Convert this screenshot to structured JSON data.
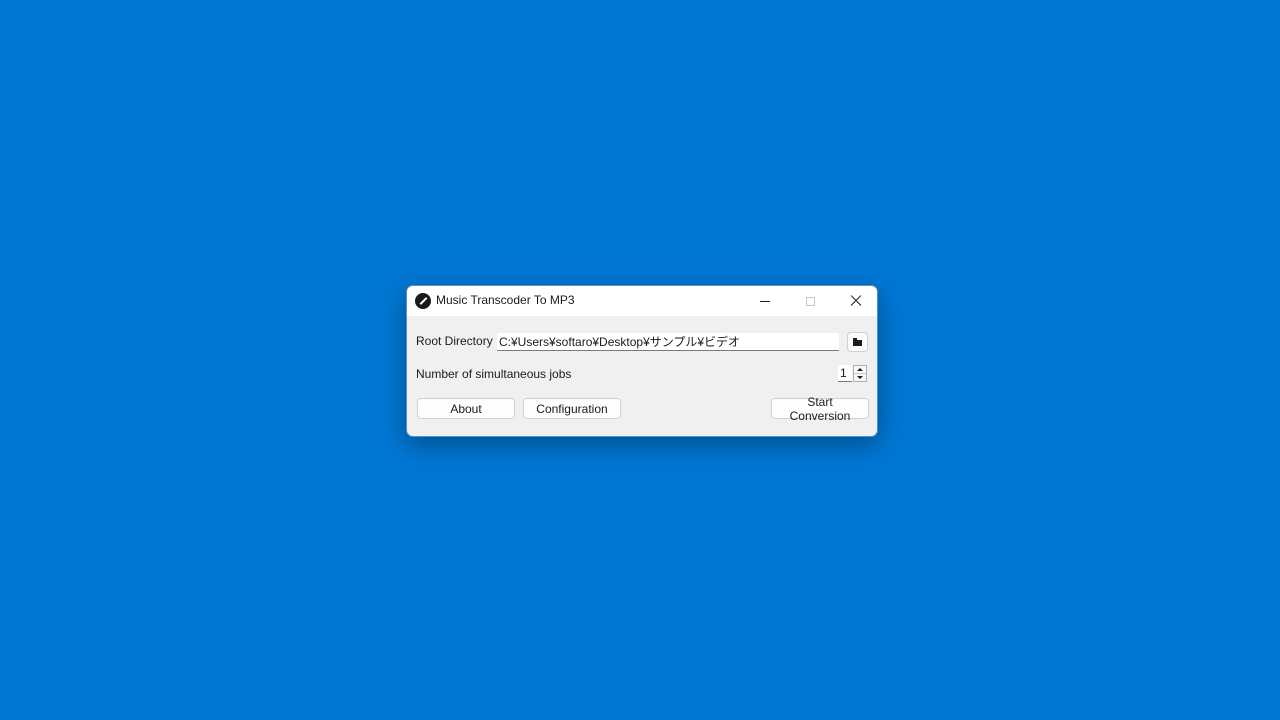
{
  "window": {
    "title": "Music Transcoder To MP3",
    "icon": "app-disc-icon"
  },
  "titlebar_controls": {
    "minimize": "minimize-icon",
    "maximize": "maximize-icon",
    "close": "close-icon"
  },
  "form": {
    "root_directory_label": "Root Directory",
    "root_directory_value": "C:¥Users¥softaro¥Desktop¥サンプル¥ビデオ",
    "browse_icon": "folder-icon",
    "jobs_label": "Number of simultaneous jobs",
    "jobs_value": "1"
  },
  "buttons": {
    "about": "About",
    "configuration": "Configuration",
    "start": "Start Conversion"
  },
  "colors": {
    "desktop": "#0078d4",
    "window_bg": "#f0f0f0",
    "titlebar_bg": "#ffffff"
  }
}
